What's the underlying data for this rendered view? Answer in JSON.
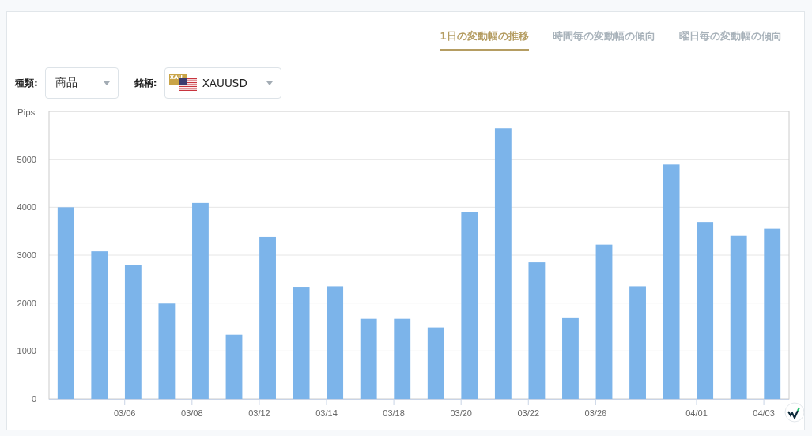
{
  "tabs": [
    {
      "label": "1日の変動幅の推移",
      "selected": true
    },
    {
      "label": "時間毎の変動幅の傾向",
      "selected": false
    },
    {
      "label": "曜日毎の変動幅の傾向",
      "selected": false
    }
  ],
  "filters": [
    {
      "label": "種類:",
      "value": "商品",
      "kind": "plain"
    },
    {
      "label": "銘柄:",
      "value": "XAUUSD",
      "kind": "flag",
      "badge": "XAU"
    }
  ],
  "chart_data": {
    "type": "bar",
    "ylabel": "Pips",
    "categories": [
      null,
      null,
      "03/06",
      null,
      "03/08",
      null,
      "03/12",
      null,
      "03/14",
      null,
      "03/18",
      null,
      "03/20",
      null,
      "03/22",
      null,
      "03/26",
      null,
      null,
      "04/01",
      null,
      "04/03"
    ],
    "series": [
      {
        "color": "#7cb4ea",
        "values": [
          4000,
          3080,
          2800,
          1990,
          4090,
          1340,
          3380,
          2340,
          2350,
          1670,
          1670,
          1490,
          3890,
          5650,
          2850,
          1700,
          3220,
          2350,
          4890,
          3690,
          3400,
          3550
        ]
      }
    ],
    "ylim": [
      0,
      6000
    ],
    "grid": true,
    "yticks": [
      0,
      1000,
      2000,
      3000,
      4000,
      5000
    ]
  }
}
